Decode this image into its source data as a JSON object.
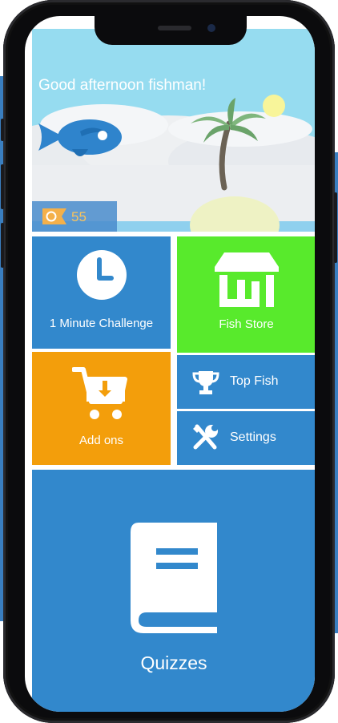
{
  "greeting": "Good afternoon fishman!",
  "coins": "55",
  "tiles": {
    "challenge": "1 Minute Challenge",
    "store": "Fish Store",
    "addons": "Add ons",
    "top_fish": "Top Fish",
    "settings": "Settings",
    "quizzes": "Quizzes"
  },
  "icons": {
    "challenge": "clock-icon",
    "store": "store-icon",
    "addons": "cart-download-icon",
    "top_fish": "trophy-icon",
    "settings": "tools-icon",
    "quizzes": "book-icon",
    "coin": "coin-tag-icon"
  },
  "colors": {
    "sky": "#96dcf0",
    "blue_tile": "#3288cc",
    "green_tile": "#58ea2c",
    "orange_tile": "#f39e0b",
    "coin_text": "#f7c35e"
  }
}
